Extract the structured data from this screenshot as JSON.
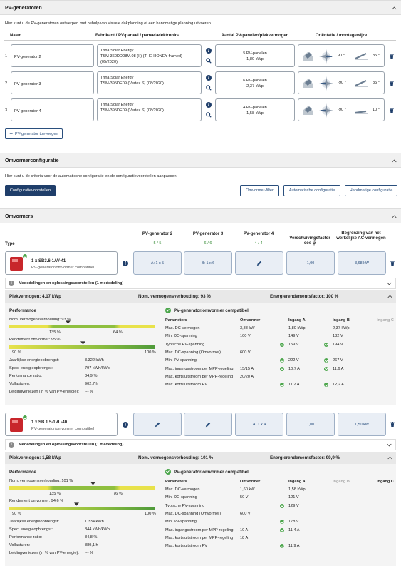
{
  "pvgen": {
    "title": "PV-generatoren",
    "intro": "Hier kunt u de PV-generatoren ontwerpen met behulp van visuele dakplanning of een handmatige planning uitvoeren.",
    "headers": {
      "name": "Naam",
      "module": "Fabrikant / PV-paneel / paneel-elektronica",
      "count": "Aantal PV-panelen/piekvermogen",
      "orient": "Oriëntatie / montagewijze"
    },
    "rows": [
      {
        "idx": "1",
        "name": "PV-generator 2",
        "mfr": "Trina Solar Energy",
        "model": "TSM-360DD08M.08 (II) (THE HONEY framed)",
        "date": "(05/2020)",
        "panels": "5 PV-panelen",
        "kwp": "1,80 kWp",
        "az": "90 °",
        "tilt": "35 °"
      },
      {
        "idx": "2",
        "name": "PV-generator 3",
        "mfr": "Trina Solar Energy",
        "model": "TSM-395DE09 (Vertex S) (08/2020)",
        "date": "",
        "panels": "6 PV-panelen",
        "kwp": "2,37 kWp",
        "az": "-90 °",
        "tilt": "35 °"
      },
      {
        "idx": "3",
        "name": "PV-generator 4",
        "mfr": "Trina Solar Energy",
        "model": "TSM-395DE09 (Vertex S) (08/2020)",
        "date": "",
        "panels": "4 PV-panelen",
        "kwp": "1,58 kWp",
        "az": "-90 °",
        "tilt": "10 °"
      }
    ],
    "add": "PV-generator toevoegen"
  },
  "config": {
    "title": "Omvormerconfiguratie",
    "intro": "Hier kunt u de criteria voor de automatische configuratie en de configuratievoorstellen aanpassen.",
    "proposals": "Configuratievoorstellen",
    "filter": "Omvormer-filter",
    "auto": "Automatische configuratie",
    "manual": "Handmatige configuratie"
  },
  "inv": {
    "title": "Omvormers",
    "type": "Type",
    "cols": [
      {
        "h": "PV-generator 2",
        "s": "5 / 5"
      },
      {
        "h": "PV-generator 3",
        "s": "6 / 6"
      },
      {
        "h": "PV-generator 4",
        "s": "4 / 4"
      }
    ],
    "cosphi_h": "Verschuivingsfactor",
    "cosphi_s": "cos φ",
    "limit_h": "Begrenzing van het werkelijke AC-vermogen",
    "units": [
      {
        "name": "1 x SB3.6-1AV-41",
        "compat": "PV-generator/omvormer compatibel",
        "c1": "A: 1 x 5",
        "c2": "B: 1 x 6",
        "c3": "",
        "cos": "1,00",
        "lim": "3,68 kW",
        "msg": "Mededelingen en oplossingsvoorstellen (1 mededeling)",
        "peak": "Piekvermogen: 4,17 kWp",
        "ratio": "Nom. vermogensverhouding: 93 %",
        "eff": "Energierendementsfactor: 100 %",
        "perf": "Performance",
        "pv_ok": "PV-generator/omvormer compatibel",
        "nvv": "Nom. vermogensverhouding: 93 %",
        "nvv_l": "135 %",
        "nvv_r": "64 %",
        "nvv_pos": 0.4,
        "rend": "Rendement omvormer: 95 %",
        "rend_l": "90 %",
        "rend_r": "100 %",
        "rend_pos": 0.5,
        "stats": [
          [
            "Jaarlijkse energieopbrengst:",
            "3.322 kWh"
          ],
          [
            "Spec. energieopbrengst:",
            "797 kWh/kWp"
          ],
          [
            "Performance ratio:",
            "84,9 %"
          ],
          [
            "Vollasturen:",
            "902,7 h"
          ],
          [
            "Leidingverliezen (in % van PV-energie):",
            "--- %"
          ]
        ],
        "ph": [
          "Parameters",
          "Omvormer",
          "Ingang A",
          "Ingang B",
          "Ingang C"
        ],
        "params": [
          [
            "Max. DC-vermogen",
            "3,88 kW",
            "1,80 kWp",
            "2,37 kWp",
            ""
          ],
          [
            "Min. DC-spanning",
            "100 V",
            "149 V",
            "182 V",
            ""
          ],
          [
            "Typische PV-spanning",
            "",
            "159 V",
            "194 V",
            ""
          ],
          [
            "Max. DC-spanning (Omvormer)",
            "600 V",
            "",
            "",
            ""
          ],
          [
            "Min. PV-spanning",
            "",
            "222 V",
            "267 V",
            ""
          ],
          [
            "Max. ingangsstroom per MPP-regeling",
            "15/15 A",
            "10,7 A",
            "11,6 A",
            ""
          ],
          [
            "Max. kortsluitstroom per MPP-regeling",
            "20/20 A",
            "",
            "",
            ""
          ],
          [
            "Max. kortsluitstroom PV",
            "",
            "11,2 A",
            "12,2 A",
            ""
          ]
        ]
      },
      {
        "name": "1 x SB 1.5-1VL-40",
        "compat": "PV-generator/omvormer compatibel",
        "c1": "",
        "c2": "",
        "c3": "A: 1 x 4",
        "cos": "1,00",
        "lim": "1,50 kW",
        "msg": "Mededelingen en oplossingsvoorstellen (1 mededeling)",
        "peak": "Piekvermogen: 1,58 kWp",
        "ratio": "Nom. vermogensverhouding: 101 %",
        "eff": "Energierendementsfactor: 99,9 %",
        "perf": "Performance",
        "pv_ok": "PV-generator/omvormer compatibel",
        "nvv": "Nom. vermogensverhouding: 101 %",
        "nvv_l": "135 %",
        "nvv_r": "76 %",
        "nvv_pos": 0.57,
        "rend": "Rendement omvormer: 94,6 %",
        "rend_l": "90 %",
        "rend_r": "100 %",
        "rend_pos": 0.46,
        "stats": [
          [
            "Jaarlijkse energieopbrengst:",
            "1.334 kWh"
          ],
          [
            "Spec. energieopbrengst:",
            "844 kWh/kWp"
          ],
          [
            "Performance ratio:",
            "84,8 %"
          ],
          [
            "Vollasturen:",
            "889,1 h"
          ],
          [
            "Leidingverliezen (in % van PV-energie):",
            "--- %"
          ]
        ],
        "ph": [
          "Parameters",
          "Omvormer",
          "Ingang A",
          "Ingang B",
          "Ingang C"
        ],
        "params": [
          [
            "Max. DC-vermogen",
            "1,60 kW",
            "1,58 kWp",
            "",
            ""
          ],
          [
            "Min. DC-spanning",
            "50 V",
            "121 V",
            "",
            ""
          ],
          [
            "Typische PV-spanning",
            "",
            "129 V",
            "",
            ""
          ],
          [
            "Max. DC-spanning (Omvormer)",
            "600 V",
            "",
            "",
            ""
          ],
          [
            "Min. PV-spanning",
            "",
            "178 V",
            "",
            ""
          ],
          [
            "Max. ingangsstroom per MPP-regeling",
            "10 A",
            "11,4 A",
            "",
            ""
          ],
          [
            "Max. kortsluitstroom per MPP-regeling",
            "18 A",
            "",
            "",
            ""
          ],
          [
            "Max. kortsluitstroom PV",
            "",
            "11,9 A",
            "",
            ""
          ]
        ]
      }
    ]
  },
  "icons": {
    "chevron": "chevron-up-icon",
    "info": "info-icon",
    "search": "magnifier-icon",
    "trash": "trash-icon",
    "pencil": "pencil-icon",
    "check": "check-icon"
  },
  "colors": {
    "accent": "#1f3e6a",
    "ok": "#4ca64c",
    "panel": "#f4f4f4"
  }
}
